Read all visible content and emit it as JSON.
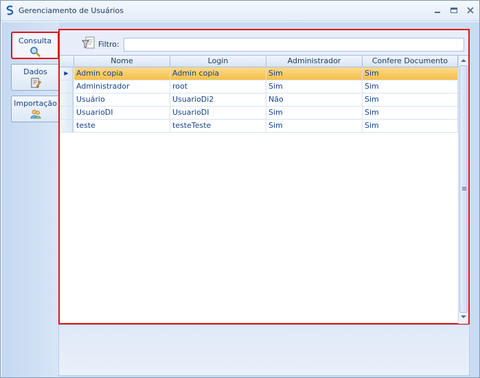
{
  "window": {
    "title": "Gerenciamento de Usuários"
  },
  "sidebar": {
    "tabs": [
      {
        "label": "Consulta",
        "icon": "magnifier-icon",
        "active": true
      },
      {
        "label": "Dados",
        "icon": "edit-document-icon",
        "active": false
      },
      {
        "label": "Importação",
        "icon": "users-import-icon",
        "active": false
      }
    ]
  },
  "filter": {
    "label": "Filtro:",
    "value": "",
    "placeholder": ""
  },
  "grid": {
    "columns": [
      "Nome",
      "Login",
      "Administrador",
      "Confere Documento"
    ],
    "rows": [
      {
        "nome": "Admin copia",
        "login": "Admin copia",
        "administrador": "Sim",
        "confere_documento": "Sim",
        "selected": true
      },
      {
        "nome": "Administrador",
        "login": "root",
        "administrador": "Sim",
        "confere_documento": "Sim",
        "selected": false
      },
      {
        "nome": "Usuário",
        "login": "UsuarioDi2",
        "administrador": "Não",
        "confere_documento": "Sim",
        "selected": false
      },
      {
        "nome": "UsuarioDI",
        "login": "UsuarioDI",
        "administrador": "Sim",
        "confere_documento": "Sim",
        "selected": false
      },
      {
        "nome": "teste",
        "login": "testeTeste",
        "administrador": "Sim",
        "confere_documento": "Sim",
        "selected": false
      }
    ]
  },
  "colors": {
    "highlight_border": "#e0121c",
    "selected_row": "#f7bf4b",
    "text": "#15428b",
    "background": "#cadcf3"
  }
}
